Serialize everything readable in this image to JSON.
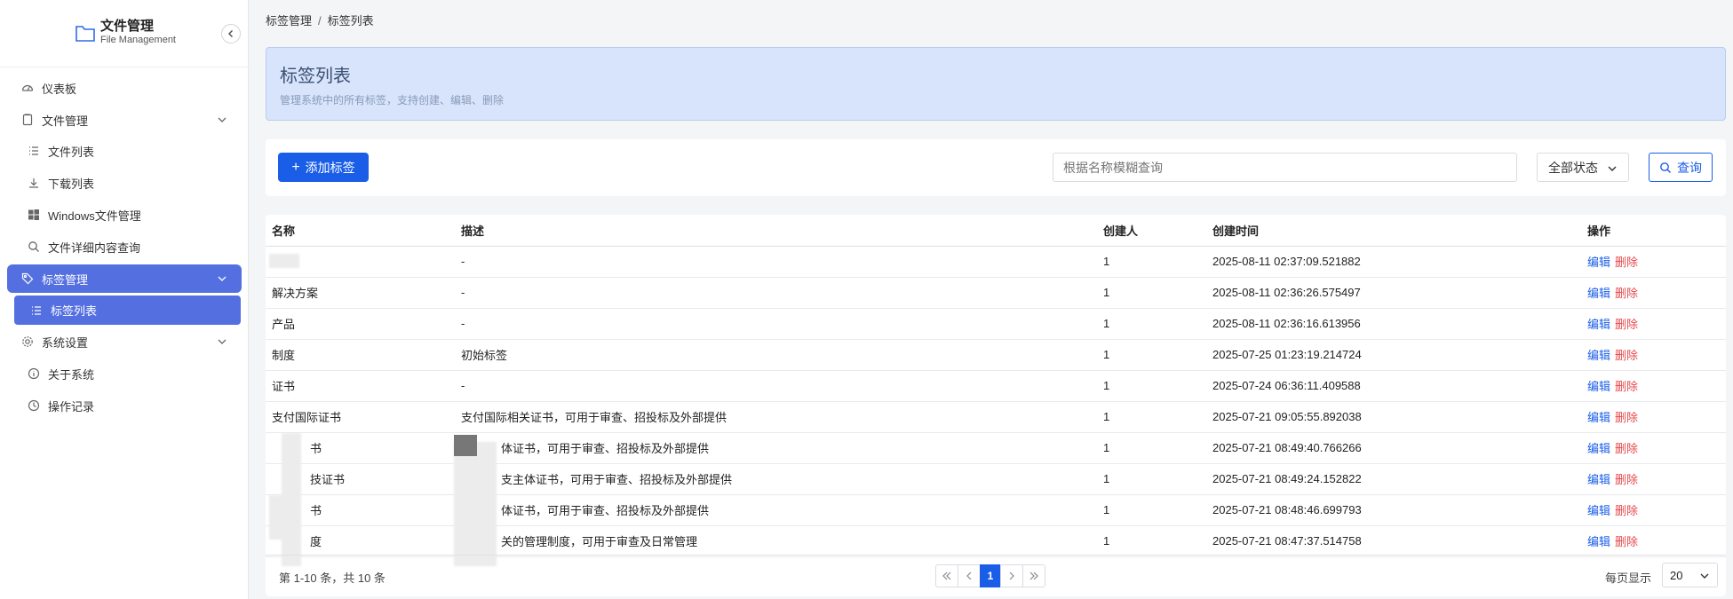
{
  "app": {
    "title": "文件管理",
    "subtitle": "File Management"
  },
  "sidebar": {
    "items": [
      {
        "label": "仪表板",
        "icon": "dashboard-icon"
      },
      {
        "label": "文件管理",
        "icon": "file-icon"
      },
      {
        "label": "文件列表",
        "icon": "list-icon"
      },
      {
        "label": "下载列表",
        "icon": "download-icon"
      },
      {
        "label": "Windows文件管理",
        "icon": "windows-icon"
      },
      {
        "label": "文件详细内容查询",
        "icon": "search-icon"
      },
      {
        "label": "标签管理",
        "icon": "tag-icon"
      },
      {
        "label": "标签列表",
        "icon": "list-icon"
      },
      {
        "label": "系统设置",
        "icon": "gear-icon"
      },
      {
        "label": "关于系统",
        "icon": "info-icon"
      },
      {
        "label": "操作记录",
        "icon": "clock-icon"
      }
    ]
  },
  "breadcrumb": {
    "parent": "标签管理",
    "separator": "/",
    "current": "标签列表"
  },
  "banner": {
    "title": "标签列表",
    "description": "管理系统中的所有标签，支持创建、编辑、删除"
  },
  "toolbar": {
    "add_label": "添加标签",
    "search_placeholder": "根据名称模糊查询",
    "status_value": "全部状态",
    "query_label": "查询"
  },
  "table": {
    "headers": [
      "名称",
      "描述",
      "创建人",
      "创建时间",
      "操作"
    ],
    "edit_label": "编辑",
    "delete_label": "删除",
    "rows": [
      {
        "name": "",
        "desc": "-",
        "creator": "1",
        "time": "2025-08-11 02:37:09.521882"
      },
      {
        "name": "解决方案",
        "desc": "-",
        "creator": "1",
        "time": "2025-08-11 02:36:26.575497"
      },
      {
        "name": "产品",
        "desc": "-",
        "creator": "1",
        "time": "2025-08-11 02:36:16.613956"
      },
      {
        "name": "制度",
        "desc": "初始标签",
        "creator": "1",
        "time": "2025-07-25 01:23:19.214724"
      },
      {
        "name": "证书",
        "desc": "-",
        "creator": "1",
        "time": "2025-07-24 06:36:11.409588"
      },
      {
        "name": "支付国际证书",
        "desc": "支付国际相关证书，可用于审查、招投标及外部提供",
        "creator": "1",
        "time": "2025-07-21 09:05:55.892038"
      },
      {
        "name": "书",
        "desc": "体证书，可用于审查、招投标及外部提供",
        "creator": "1",
        "time": "2025-07-21 08:49:40.766266"
      },
      {
        "name": "技证书",
        "desc": "支主体证书，可用于审查、招投标及外部提供",
        "creator": "1",
        "time": "2025-07-21 08:49:24.152822"
      },
      {
        "name": "书",
        "desc": "体证书，可用于审查、招投标及外部提供",
        "creator": "1",
        "time": "2025-07-21 08:48:46.699793"
      },
      {
        "name": "度",
        "desc": "关的管理制度，可用于审查及日常管理",
        "creator": "1",
        "time": "2025-07-21 08:47:37.514758"
      }
    ]
  },
  "footer": {
    "total_text": "第 1-10 条，共 10 条",
    "current_page": "1",
    "page_size_label": "每页显示",
    "page_size": "20"
  },
  "colors": {
    "primary": "#1a5ee8",
    "menu_active": "#5470e0",
    "danger": "#e5484d",
    "banner_bg": "#d7e4fb"
  }
}
